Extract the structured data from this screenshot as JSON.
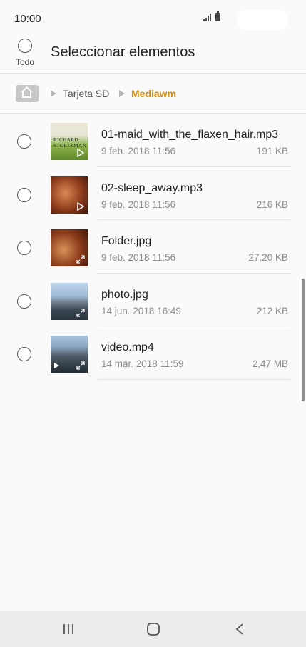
{
  "status": {
    "time": "10:00"
  },
  "header": {
    "select_all_label": "Todo",
    "title": "Seleccionar elementos"
  },
  "breadcrumb": {
    "items": [
      "Tarjeta SD",
      "Mediawm"
    ]
  },
  "thumbnail_text": {
    "album_cover": "RICHARD STOLTZMAN"
  },
  "files": [
    {
      "name": "01-maid_with_the_flaxen_hair.mp3",
      "date": "9 feb. 2018 11:56",
      "size": "191 KB",
      "type": "audio"
    },
    {
      "name": "02-sleep_away.mp3",
      "date": "9 feb. 2018 11:56",
      "size": "216 KB",
      "type": "audio"
    },
    {
      "name": "Folder.jpg",
      "date": "9 feb. 2018 11:56",
      "size": "27,20 KB",
      "type": "image"
    },
    {
      "name": "photo.jpg",
      "date": "14 jun. 2018 16:49",
      "size": "212 KB",
      "type": "image"
    },
    {
      "name": "video.mp4",
      "date": "14 mar. 2018 11:59",
      "size": "2,47 MB",
      "type": "video"
    }
  ],
  "colors": {
    "accent": "#d68f12",
    "background": "#fafafa",
    "secondary_text": "#8a8a8a"
  },
  "icons": [
    "signal-icon",
    "battery-icon",
    "home-folder-icon",
    "chevron-right-icon",
    "play-icon",
    "expand-icon",
    "recent-apps-icon",
    "home-icon",
    "back-icon"
  ]
}
